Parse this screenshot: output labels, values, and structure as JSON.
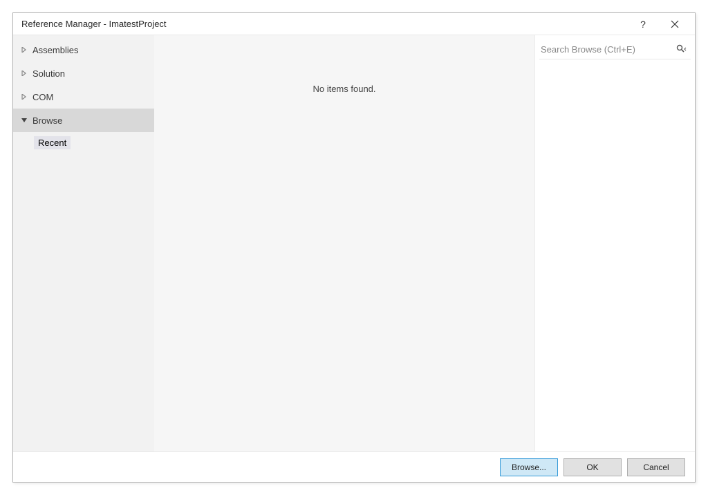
{
  "title": "Reference Manager - ImatestProject",
  "sidebar": {
    "items": [
      {
        "label": "Assemblies",
        "expanded": false,
        "selected": false
      },
      {
        "label": "Solution",
        "expanded": false,
        "selected": false
      },
      {
        "label": "COM",
        "expanded": false,
        "selected": false
      },
      {
        "label": "Browse",
        "expanded": true,
        "selected": true,
        "children": [
          {
            "label": "Recent",
            "selected": true
          }
        ]
      }
    ]
  },
  "main": {
    "empty_message": "No items found."
  },
  "search": {
    "placeholder": "Search Browse (Ctrl+E)"
  },
  "footer": {
    "browse_label": "Browse...",
    "ok_label": "OK",
    "cancel_label": "Cancel"
  }
}
